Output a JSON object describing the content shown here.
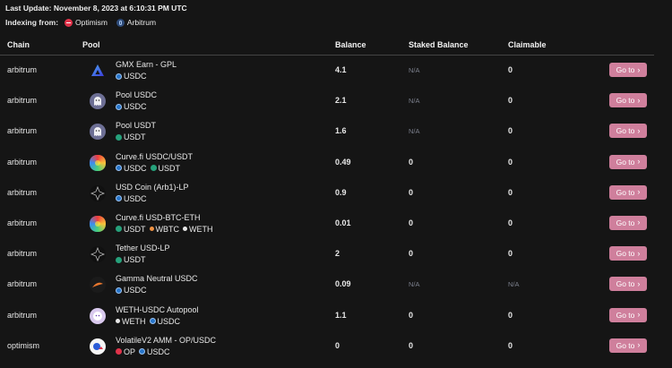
{
  "header": {
    "last_update": "Last Update: November 8, 2023 at 6:10:31 PM UTC",
    "indexing_label": "Indexing from:",
    "networks": [
      {
        "name": "Optimism",
        "icon": "optimism-icon",
        "color": "#e0334a"
      },
      {
        "name": "Arbitrum",
        "icon": "arbitrum-icon",
        "color": "#2d4a78"
      }
    ]
  },
  "table": {
    "columns": {
      "chain": "Chain",
      "pool": "Pool",
      "balance": "Balance",
      "staked": "Staked Balance",
      "claimable": "Claimable"
    },
    "goto_label": "Go to",
    "accent_color": "#cf7f9c",
    "rows": [
      {
        "chain": "arbitrum",
        "pool": "GMX Earn - GPL",
        "icon": "gmx-icon",
        "tokens": [
          {
            "name": "USDC",
            "icon": "usdc-icon"
          }
        ],
        "balance": "4.1",
        "staked": "N/A",
        "claimable": "0"
      },
      {
        "chain": "arbitrum",
        "pool": "Pool USDC",
        "icon": "ghost-icon",
        "tokens": [
          {
            "name": "USDC",
            "icon": "usdc-icon"
          }
        ],
        "balance": "2.1",
        "staked": "N/A",
        "claimable": "0"
      },
      {
        "chain": "arbitrum",
        "pool": "Pool USDT",
        "icon": "ghost-icon",
        "tokens": [
          {
            "name": "USDT",
            "icon": "usdt-icon"
          }
        ],
        "balance": "1.6",
        "staked": "N/A",
        "claimable": "0"
      },
      {
        "chain": "arbitrum",
        "pool": "Curve.fi USDC/USDT",
        "icon": "curve-icon",
        "tokens": [
          {
            "name": "USDC",
            "icon": "usdc-icon"
          },
          {
            "name": "USDT",
            "icon": "usdt-icon"
          }
        ],
        "balance": "0.49",
        "staked": "0",
        "claimable": "0"
      },
      {
        "chain": "arbitrum",
        "pool": "USD Coin (Arb1)-LP",
        "icon": "stargate-icon",
        "tokens": [
          {
            "name": "USDC",
            "icon": "usdc-icon"
          }
        ],
        "balance": "0.9",
        "staked": "0",
        "claimable": "0"
      },
      {
        "chain": "arbitrum",
        "pool": "Curve.fi USD-BTC-ETH",
        "icon": "curve-icon",
        "tokens": [
          {
            "name": "USDT",
            "icon": "usdt-icon"
          },
          {
            "name": "WBTC",
            "icon": "wbtc-icon"
          },
          {
            "name": "WETH",
            "icon": "weth-icon"
          }
        ],
        "balance": "0.01",
        "staked": "0",
        "claimable": "0"
      },
      {
        "chain": "arbitrum",
        "pool": "Tether USD-LP",
        "icon": "stargate-icon",
        "tokens": [
          {
            "name": "USDT",
            "icon": "usdt-icon"
          }
        ],
        "balance": "2",
        "staked": "0",
        "claimable": "0"
      },
      {
        "chain": "arbitrum",
        "pool": "Gamma Neutral USDC",
        "icon": "gamma-icon",
        "tokens": [
          {
            "name": "USDC",
            "icon": "usdc-icon"
          }
        ],
        "balance": "0.09",
        "staked": "N/A",
        "claimable": "N/A"
      },
      {
        "chain": "arbitrum",
        "pool": "WETH-USDC Autopool",
        "icon": "autopool-icon",
        "tokens": [
          {
            "name": "WETH",
            "icon": "weth-icon"
          },
          {
            "name": "USDC",
            "icon": "usdc-icon"
          }
        ],
        "balance": "1.1",
        "staked": "0",
        "claimable": "0"
      },
      {
        "chain": "optimism",
        "pool": "VolatileV2 AMM - OP/USDC",
        "icon": "velodrome-icon",
        "tokens": [
          {
            "name": "OP",
            "icon": "op-token-icon"
          },
          {
            "name": "USDC",
            "icon": "usdc-icon"
          }
        ],
        "balance": "0",
        "staked": "0",
        "claimable": "0"
      }
    ]
  }
}
